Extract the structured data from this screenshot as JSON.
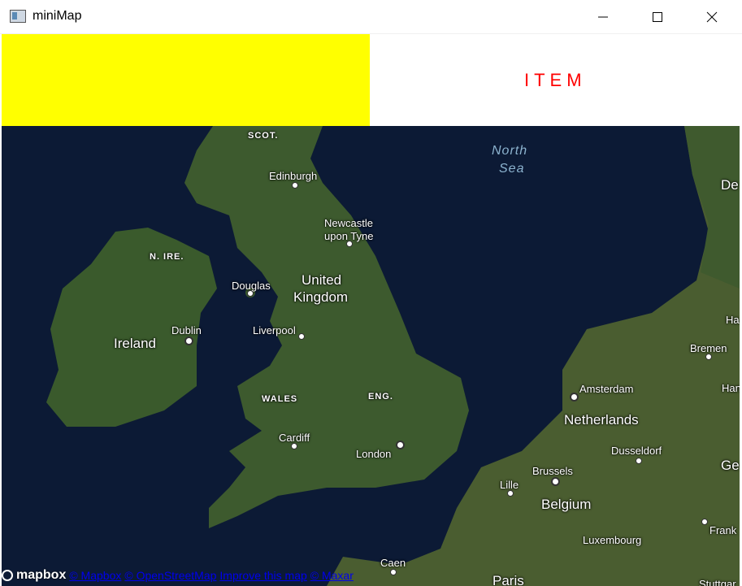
{
  "window": {
    "title": "miniMap",
    "minimize_icon": "minimize-icon",
    "maximize_icon": "maximize-icon",
    "close_icon": "close-icon"
  },
  "banner": {
    "item_text": "ITEM",
    "panel_color": "#ffff00",
    "item_color": "#ff0000"
  },
  "map": {
    "labels": {
      "scot": "SCOT.",
      "north": "North",
      "sea": "Sea",
      "edinburgh": "Edinburgh",
      "newcastle1": "Newcastle",
      "newcastle2": "upon Tyne",
      "nire": "N. IRE.",
      "uk1": "United",
      "uk2": "Kingdom",
      "douglas": "Douglas",
      "ireland": "Ireland",
      "dublin": "Dublin",
      "liverpool": "Liverpool",
      "wales": "WALES",
      "eng": "ENG.",
      "cardiff": "Cardiff",
      "london": "London",
      "amsterdam": "Amsterdam",
      "netherlands": "Netherlands",
      "bremen": "Bremen",
      "de": "De",
      "ha": "Ha",
      "han": "Han",
      "dusseldorf": "Dusseldorf",
      "ge": "Ge",
      "brussels": "Brussels",
      "lille": "Lille",
      "belgium": "Belgium",
      "frank": "Frank",
      "luxembourg": "Luxembourg",
      "caen": "Caen",
      "paris": "Paris",
      "stuttgart": "Stuttgar"
    }
  },
  "attribution": {
    "logo": "mapbox",
    "links": [
      "© Mapbox",
      "© OpenStreetMap",
      "Improve this map",
      "© Maxar"
    ]
  }
}
